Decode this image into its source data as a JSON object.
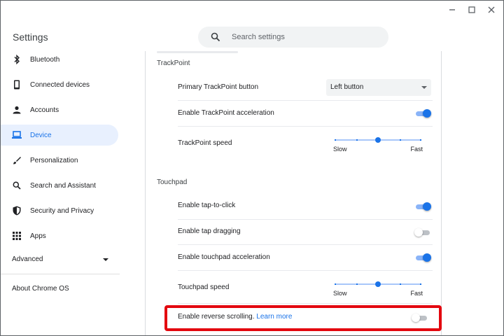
{
  "app": {
    "title": "Settings"
  },
  "search": {
    "placeholder": "Search settings",
    "value": ""
  },
  "sidebar": {
    "items": [
      {
        "label": "Bluetooth",
        "icon": "bluetooth-icon",
        "active": false
      },
      {
        "label": "Connected devices",
        "icon": "phone-icon",
        "active": false
      },
      {
        "label": "Accounts",
        "icon": "person-icon",
        "active": false
      },
      {
        "label": "Device",
        "icon": "laptop-icon",
        "active": true
      },
      {
        "label": "Personalization",
        "icon": "brush-icon",
        "active": false
      },
      {
        "label": "Search and Assistant",
        "icon": "search-icon",
        "active": false
      },
      {
        "label": "Security and Privacy",
        "icon": "shield-icon",
        "active": false
      },
      {
        "label": "Apps",
        "icon": "grid-icon",
        "active": false
      }
    ],
    "advanced_label": "Advanced",
    "about_label": "About Chrome OS"
  },
  "trackpoint": {
    "title": "TrackPoint",
    "primary_button_label": "Primary TrackPoint button",
    "primary_button_value": "Left button",
    "acceleration_label": "Enable TrackPoint acceleration",
    "acceleration_on": true,
    "speed_label": "TrackPoint speed",
    "speed_level": 0.5,
    "speed_min_label": "Slow",
    "speed_max_label": "Fast"
  },
  "touchpad": {
    "title": "Touchpad",
    "tap_to_click_label": "Enable tap-to-click",
    "tap_to_click_on": true,
    "tap_dragging_label": "Enable tap dragging",
    "tap_dragging_on": false,
    "acceleration_label": "Enable touchpad acceleration",
    "acceleration_on": true,
    "speed_label": "Touchpad speed",
    "speed_level": 0.5,
    "speed_min_label": "Slow",
    "speed_max_label": "Fast",
    "reverse_scroll_label": "Enable reverse scrolling.",
    "reverse_scroll_link": "Learn more",
    "reverse_scroll_on": false
  },
  "colors": {
    "accent": "#1a73e8",
    "highlight": "#e3070f",
    "active_bg": "#e8f0fe"
  }
}
